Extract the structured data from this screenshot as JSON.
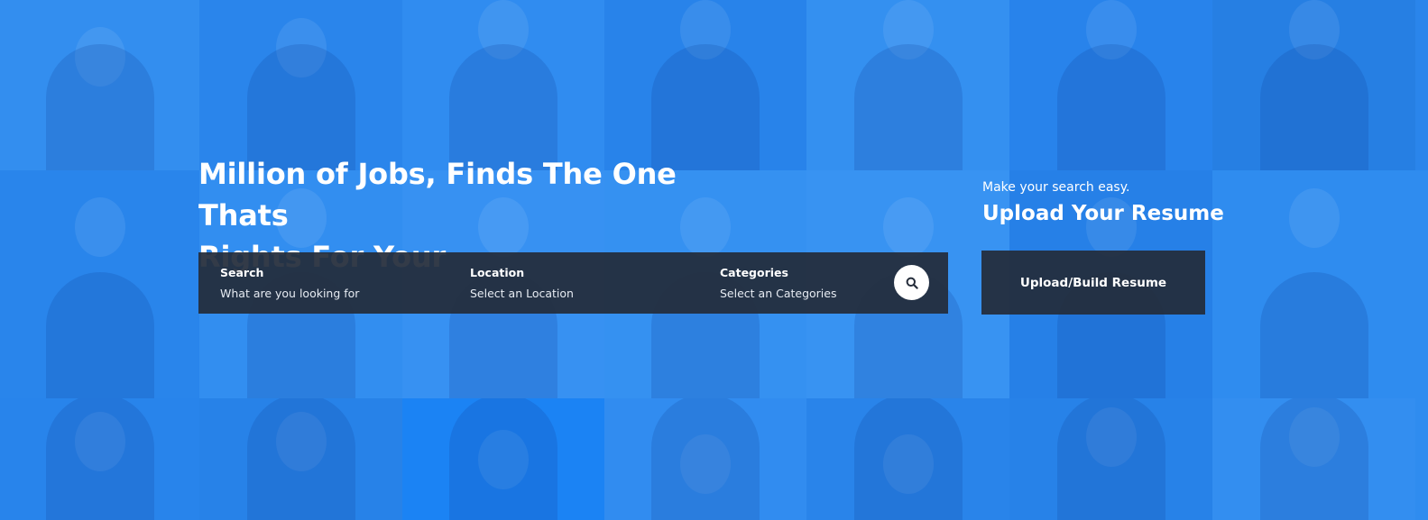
{
  "colors": {
    "background": "#2d8ef0",
    "panel": "#242c3a",
    "text": "#ffffff"
  },
  "hero": {
    "headline_line1": "Million of Jobs, Finds The One Thats",
    "headline_line2": "Rights For Your"
  },
  "search": {
    "fields": [
      {
        "label": "Search",
        "value": "What are you looking for"
      },
      {
        "label": "Location",
        "value": "Select an Location"
      },
      {
        "label": "Categories",
        "value": "Select an Categories"
      }
    ],
    "button_icon": "search-icon"
  },
  "resume": {
    "tagline": "Make your search easy.",
    "title": "Upload Your Resume",
    "button_label": "Upload/Build Resume"
  }
}
